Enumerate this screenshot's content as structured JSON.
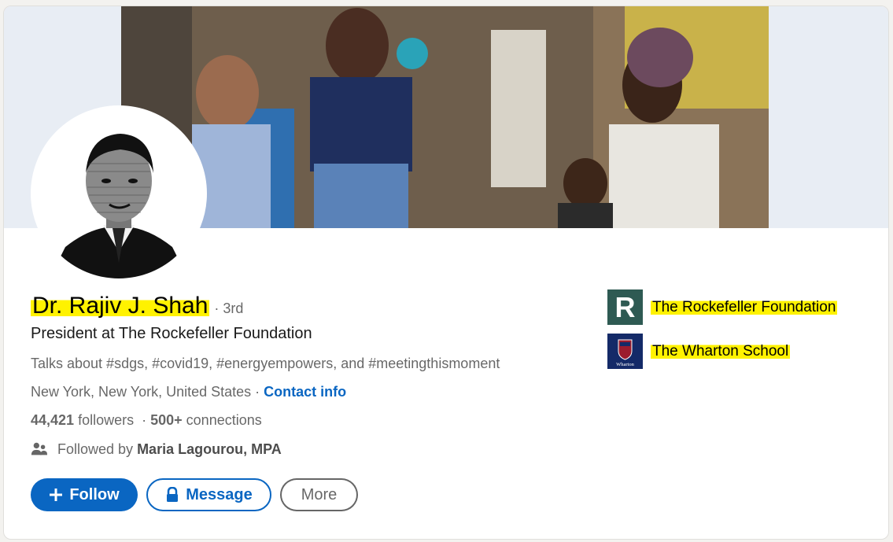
{
  "profile": {
    "name": "Dr. Rajiv J. Shah",
    "degree": "· 3rd",
    "headline": "President at The Rockefeller Foundation",
    "talks_about": "Talks about #sdgs, #covid19, #energyempowers, and #meetingthismoment",
    "location": "New York, New York, United States ·",
    "contact_info": "Contact info",
    "followers_count": "44,421",
    "followers_label": "followers",
    "connections_count": "500+",
    "connections_label": "connections",
    "followed_by_prefix": "Followed by",
    "followed_by_name": "Maria Lagourou, MPA"
  },
  "actions": {
    "follow_label": "Follow",
    "message_label": "Message",
    "more_label": "More"
  },
  "organizations": [
    {
      "name": "The Rockefeller Foundation",
      "logo_letter": "R"
    },
    {
      "name": "The Wharton School",
      "logo_text": "Wharton"
    }
  ],
  "colors": {
    "brand_blue": "#0a66c2",
    "highlight": "#fff200",
    "rockefeller_green": "#2e5a53",
    "wharton_navy": "#142a68"
  },
  "icons": [
    "plus-icon",
    "lock-icon",
    "people-icon",
    "avatar-portrait"
  ]
}
